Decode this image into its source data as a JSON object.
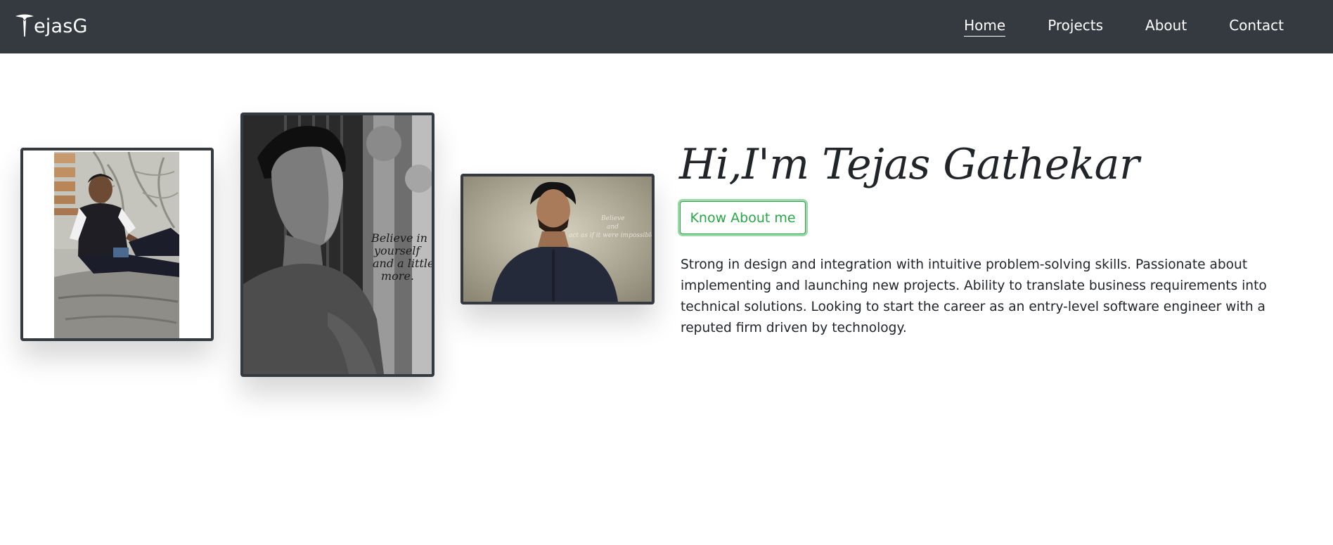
{
  "navbar": {
    "brand": "ejasG",
    "brand_icon": "tesla-logo-icon",
    "links": [
      {
        "label": "Home",
        "active": true
      },
      {
        "label": "Projects",
        "active": false
      },
      {
        "label": "About",
        "active": false
      },
      {
        "label": "Contact",
        "active": false
      }
    ]
  },
  "gallery": {
    "photos": [
      {
        "alt": "portrait-sitting-on-bench",
        "style": "color"
      },
      {
        "alt": "portrait-looking-up-bw",
        "style": "black-and-white",
        "overlay_text": "Believe in yourself and a little more."
      },
      {
        "alt": "portrait-against-wall",
        "style": "color",
        "overlay_text": "Believe and act as if it were impossible to fail"
      }
    ]
  },
  "hero": {
    "title": "Hi,I'm Tejas Gathekar",
    "button_label": "Know About me",
    "description": "Strong in design and integration with intuitive problem-solving skills. Passionate about implementing and launching new projects. Ability to translate business requirements into technical solutions. Looking to start the career as an entry-level software engineer with a reputed firm driven by technology."
  },
  "colors": {
    "navbar_bg": "#343a40",
    "accent_green": "#28a745",
    "text": "#212529"
  }
}
